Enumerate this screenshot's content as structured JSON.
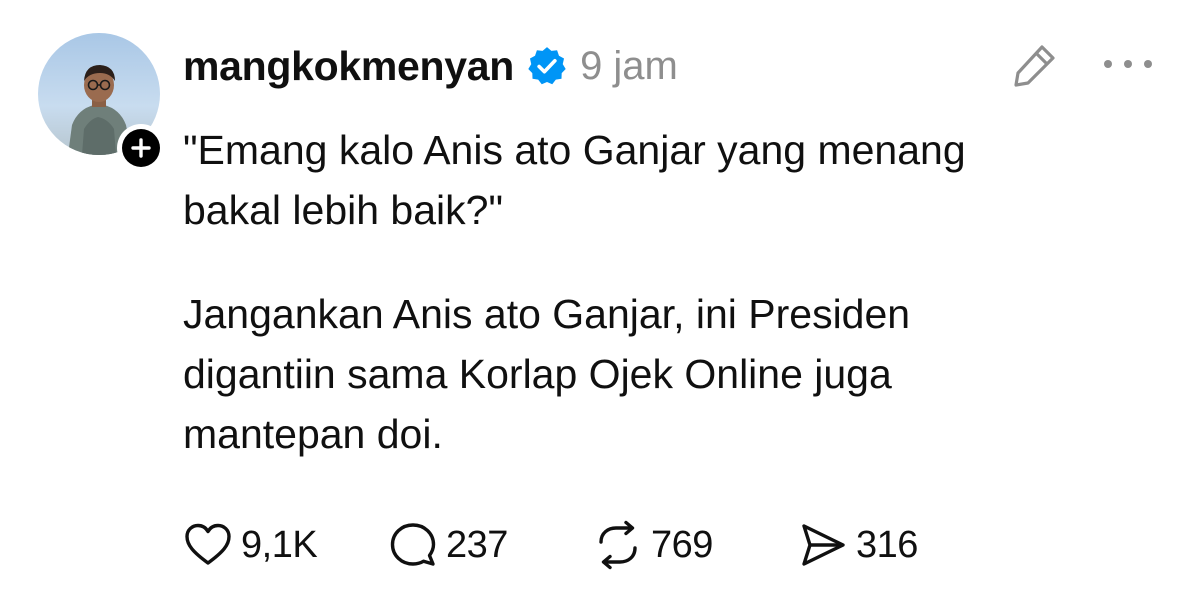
{
  "post": {
    "author": {
      "username": "mangkokmenyan",
      "verified": true,
      "avatar_icon": "profile-photo",
      "follow_icon": "plus-icon"
    },
    "timestamp": "9 jam",
    "body": {
      "paragraph_1": "\"Emang kalo Anis ato Ganjar yang menang\nbakal lebih baik?\"",
      "paragraph_2": "Jangankan Anis ato Ganjar, ini Presiden\ndigantiin sama Korlap Ojek Online juga\nmantepan doi."
    },
    "actions": {
      "like_count": "9,1K",
      "reply_count": "237",
      "repost_count": "769",
      "share_count": "316"
    },
    "icons": {
      "verified": "verified-badge-icon",
      "edit": "pencil-icon",
      "more": "more-horizontal-icon",
      "like": "heart-icon",
      "reply": "comment-icon",
      "repost": "repost-icon",
      "share": "send-icon"
    },
    "colors": {
      "text": "#101010",
      "muted": "#8e8e8e",
      "verified_blue": "#0095f6"
    }
  }
}
